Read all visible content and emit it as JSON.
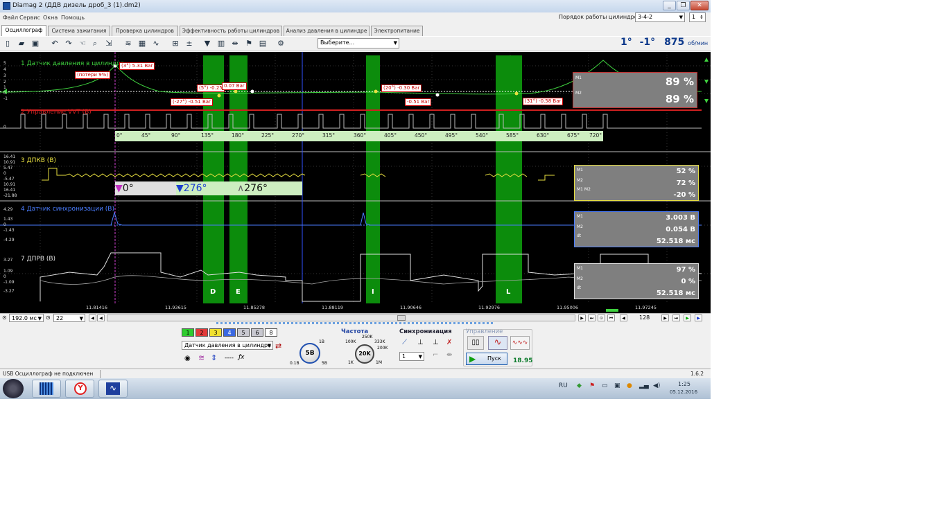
{
  "window": {
    "title": "Diamag 2 (ДДВ дизель дроб_3 (1).dm2)",
    "controls": [
      "_",
      "❐",
      "✕"
    ]
  },
  "menu": [
    "Файл",
    "Сервис",
    "Окна",
    "Помощь"
  ],
  "cyl_order": {
    "label": "Порядок работы цилиндров",
    "value": "3-4-2",
    "num": "1"
  },
  "tabs": [
    "Осциллограф",
    "Система зажигания",
    "Проверка цилиндров",
    "Эффективность работы цилиндров",
    "Анализ давления в цилиндре",
    "Электропитание"
  ],
  "toolbar": {
    "select_placeholder": "Выберите..."
  },
  "readout": {
    "a": "1°",
    "b": "-1°",
    "rpm": "875",
    "unit": "об/мин"
  },
  "channels": {
    "ch1": {
      "name": "1  Датчик давления в цилиндре",
      "color": "#3ed03e",
      "ylabels": [
        "5",
        "4",
        "3",
        "2",
        "1",
        "0",
        "-1"
      ]
    },
    "ch2": {
      "name": "2 Управление VVT (B)",
      "color": "#d02020",
      "ylabels": [
        "0"
      ]
    },
    "ch3": {
      "name": "3 ДПКВ (B)",
      "color": "#e8e040",
      "ylabels": [
        "16.41",
        "10.91",
        "5.47",
        "0",
        "-5.47",
        "10.91",
        "16.41",
        "-21.88"
      ]
    },
    "ch4": {
      "name": "4 Датчик синхронизации (B)",
      "color": "#4a7dff",
      "ylabels": [
        "4.29",
        "1.43",
        "0",
        "-1.43",
        "-4.29"
      ]
    },
    "ch7": {
      "name": "7 ДПРВ (B)",
      "color": "#e0e0e0",
      "ylabels": [
        "3.27",
        "1.09",
        "0",
        "-1.09",
        "-3.27"
      ]
    }
  },
  "tags": [
    "(3°) 5.31 Bar",
    "(потери 9%)",
    "(5°) -0.25",
    "0.07 Bar",
    "(-27°) -0.51 Bar",
    "(20°) -0.30 Bar",
    "-0.51 Bar",
    "(31°) -0.58 Bar"
  ],
  "box1": {
    "m1": "M1",
    "m2": "M2",
    "v1": "89 %",
    "v2": "89 %"
  },
  "box3": {
    "l1": "M1",
    "l2": "M2",
    "l3": "M1 M2",
    "v1": "52 %",
    "v2": "72 %",
    "v3": "-20 %"
  },
  "box4": {
    "l1": "M1",
    "l2": "M2",
    "l3": "dt",
    "v1": "3.003 В",
    "v2": "0.054 В",
    "v3": "52.518 мс"
  },
  "box7": {
    "l1": "M1",
    "l2": "M2",
    "l3": "dt",
    "v1": "97 %",
    "v2": "0 %",
    "v3": "52.518 мс"
  },
  "ruler": [
    "0°",
    "45°",
    "90°",
    "135°",
    "180°",
    "225°",
    "270°",
    "315°",
    "360°",
    "405°",
    "450°",
    "495°",
    "540°",
    "585°",
    "630°",
    "675°",
    "720°"
  ],
  "cursors": {
    "c1": "0°",
    "c2": "276°",
    "c3": "276°"
  },
  "bands": [
    "D",
    "E",
    "I",
    "L"
  ],
  "time_labels": [
    "11.81416",
    "11.93615",
    "11.85278",
    "11.88119",
    "11.90646",
    "11.92976",
    "11.95006",
    "11.97245"
  ],
  "scroll": {
    "timebase": "192.0 мс",
    "scale": "22",
    "page": "128"
  },
  "channel_buttons": [
    "1",
    "2",
    "3",
    "4",
    "5",
    "6",
    "8"
  ],
  "channel_colors": [
    "#2ecc2e",
    "#e23a3a",
    "#f0e030",
    "#3a68e0",
    "#9aa0b0",
    "#9aa0b0",
    "#ffffff"
  ],
  "ctrl": {
    "channel_select": "Датчик давления в цилиндре",
    "volt_knob": "5В",
    "volt_range": [
      "0.1В",
      "5В",
      "1В"
    ],
    "freq_title": "Частота",
    "freq_knob": "20K",
    "freq_marks": [
      "100K",
      "250K",
      "333K",
      "200K",
      "1K",
      "1M"
    ],
    "sync_title": "Синхронизация",
    "sync_value": "1",
    "mgmt_title": "Управление",
    "start_label": "Пуск",
    "elapsed": "18.95"
  },
  "status": {
    "left": "USB Осциллограф не подключен",
    "right": "1.6.2"
  },
  "taskbar": {
    "time": "1:25",
    "date": "05.12.2016",
    "lang": "RU"
  }
}
